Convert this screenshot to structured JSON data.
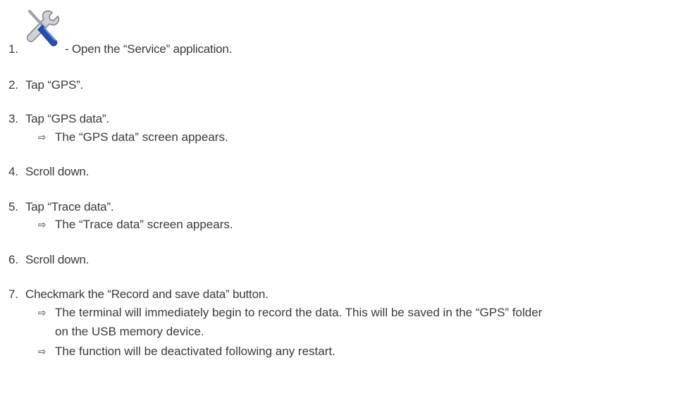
{
  "steps": [
    {
      "num": "1.",
      "text": "- Open the “Service” application.",
      "icon": "wrench-screwdriver-icon"
    },
    {
      "num": "2.",
      "text": "Tap “GPS”."
    },
    {
      "num": "3.",
      "text": "Tap “GPS data”.",
      "results": [
        "The “GPS data” screen appears."
      ]
    },
    {
      "num": "4.",
      "text": "Scroll down."
    },
    {
      "num": "5.",
      "text": "Tap “Trace data”.",
      "results": [
        "The “Trace data” screen appears."
      ]
    },
    {
      "num": "6.",
      "text": "Scroll down."
    },
    {
      "num": "7.",
      "text": "Checkmark the “Record and save data” button.",
      "results": [
        "The terminal will immediately begin to record the data. This will be saved in the “GPS” folder",
        "on the USB memory device.",
        "The function will be deactivated following any restart."
      ]
    }
  ],
  "arrow": "⇨"
}
